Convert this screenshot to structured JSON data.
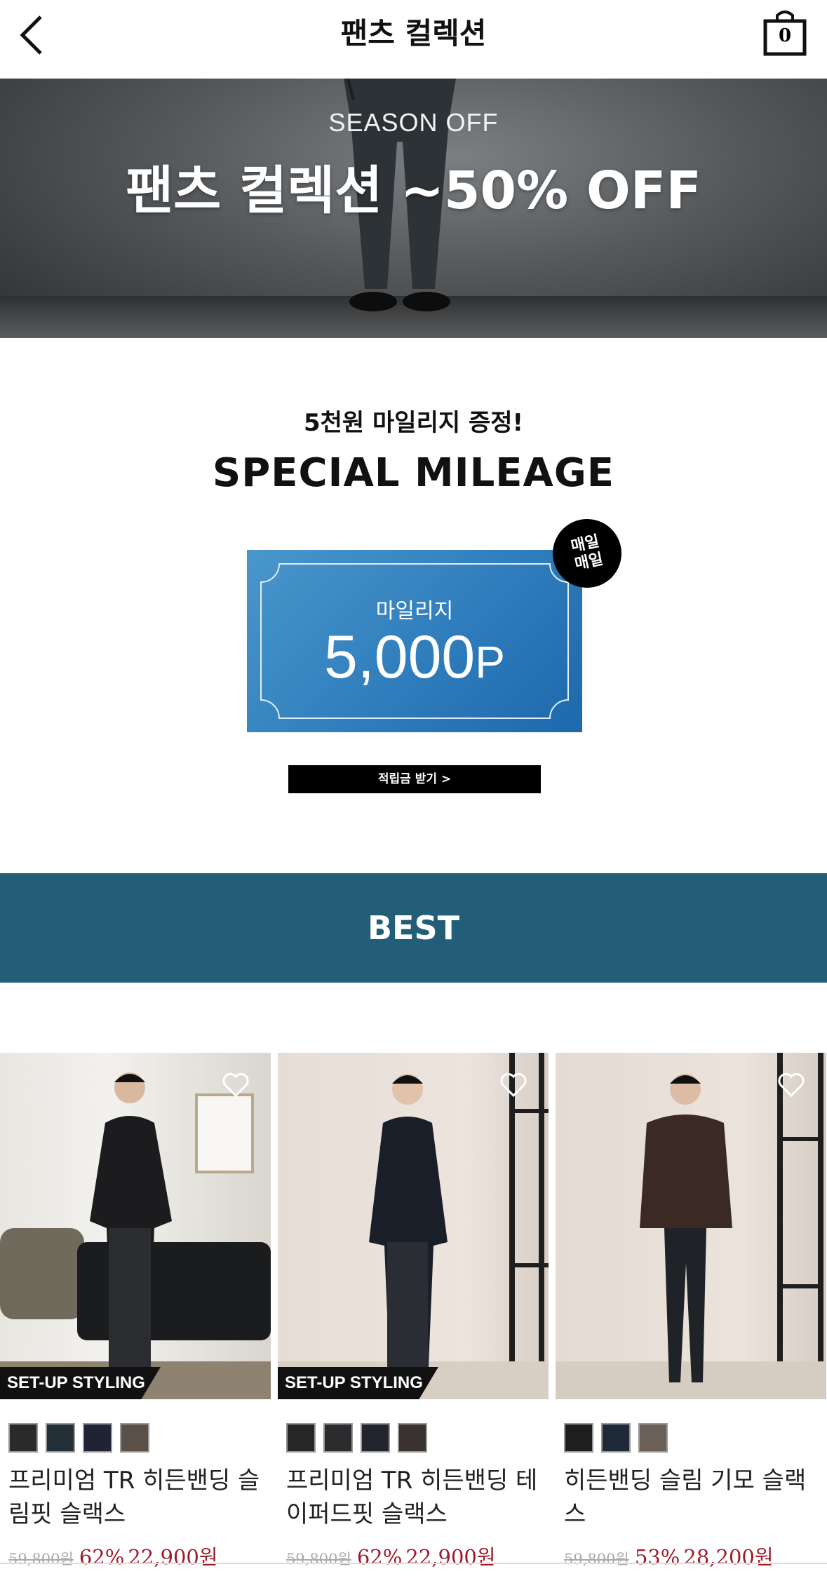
{
  "header": {
    "title": "팬츠 컬렉션",
    "cart_count": "0"
  },
  "hero": {
    "subtitle": "SEASON OFF",
    "title": "팬츠 컬렉션 ~50% OFF"
  },
  "mileage": {
    "subtitle": "5천원 마일리지 증정!",
    "title": "SPECIAL MILEAGE",
    "coupon_label": "마일리지",
    "coupon_amount": "5,000",
    "coupon_unit": "P",
    "badge_line1": "매일",
    "badge_line2": "매일",
    "button_label": "적립금 받기 >"
  },
  "best": {
    "label": "BEST"
  },
  "products": [
    {
      "tag": "SET-UP STYLING",
      "swatches": [
        "#2a2a2a",
        "#243038",
        "#1f2333",
        "#5b5048"
      ],
      "name": "프리미엄 TR 히든밴딩 슬림핏 슬랙스",
      "original_price": "59,800원",
      "discount": "62%",
      "sale_price": "22,900원"
    },
    {
      "tag": "SET-UP STYLING",
      "swatches": [
        "#262626",
        "#2c2c2e",
        "#22242e",
        "#3a3230"
      ],
      "name": "프리미엄 TR 히든밴딩 테이퍼드핏 슬랙스",
      "original_price": "59,800원",
      "discount": "62%",
      "sale_price": "22,900원"
    },
    {
      "tag": "",
      "swatches": [
        "#1e1e1e",
        "#1f2a38",
        "#6b6058"
      ],
      "name": "히든밴딩 슬림 기모 슬랙스",
      "original_price": "59,800원",
      "discount": "53%",
      "sale_price": "28,200원"
    }
  ]
}
